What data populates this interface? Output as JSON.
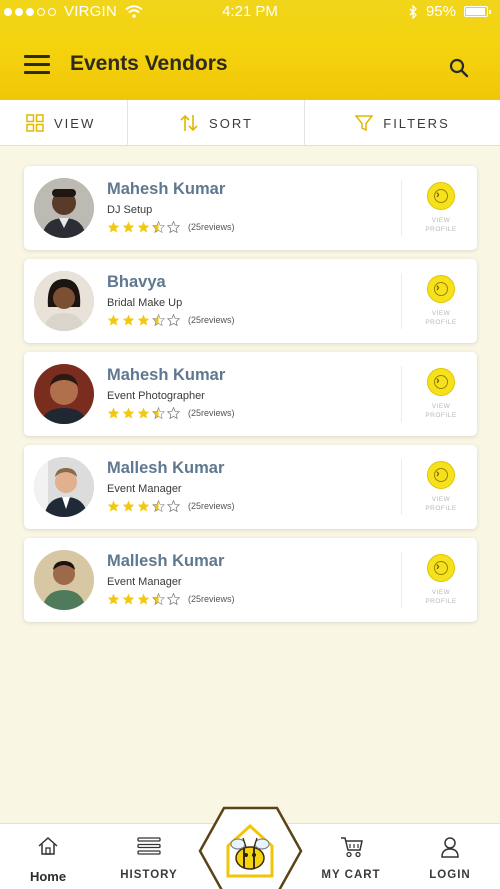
{
  "status_bar": {
    "carrier": "VIRGIN",
    "time": "4:21 PM",
    "battery": "95%"
  },
  "header": {
    "title": "Events Vendors"
  },
  "toolbar": {
    "view_label": "VIEW",
    "sort_label": "SORT",
    "filters_label": "FILTERS"
  },
  "vendors": [
    {
      "name": "Mahesh Kumar",
      "role": "DJ Setup",
      "rating": 3.5,
      "reviews": "(25reviews)",
      "action": "VIEW PROFILE"
    },
    {
      "name": "Bhavya",
      "role": "Bridal Make Up",
      "rating": 3.5,
      "reviews": "(25reviews)",
      "action": "VIEW PROFILE"
    },
    {
      "name": "Mahesh Kumar",
      "role": "Event Photographer",
      "rating": 3.5,
      "reviews": "(25reviews)",
      "action": "VIEW PROFILE"
    },
    {
      "name": "Mallesh Kumar",
      "role": "Event Manager",
      "rating": 3.5,
      "reviews": "(25reviews)",
      "action": "VIEW PROFILE"
    },
    {
      "name": "Mallesh Kumar",
      "role": "Event Manager",
      "rating": 3.5,
      "reviews": "(25reviews)",
      "action": "VIEW PROFILE"
    }
  ],
  "bottom_nav": {
    "home": "Home",
    "history": "HISTORY",
    "cart": "MY CART",
    "login": "LOGIN"
  },
  "icons": {
    "menu": "hamburger-menu-icon",
    "search": "search-icon",
    "view": "grid-icon",
    "sort": "sort-arrows-icon",
    "filters": "funnel-icon",
    "view_profile": "chevron-right-circle-icon",
    "home": "home-icon",
    "history": "list-icon",
    "center": "bee-house-logo",
    "cart": "cart-icon",
    "login": "user-icon"
  },
  "colors": {
    "accent": "#f4d40f",
    "name_text": "#5f7891",
    "star": "#f2c811",
    "background": "#faf6e4"
  }
}
